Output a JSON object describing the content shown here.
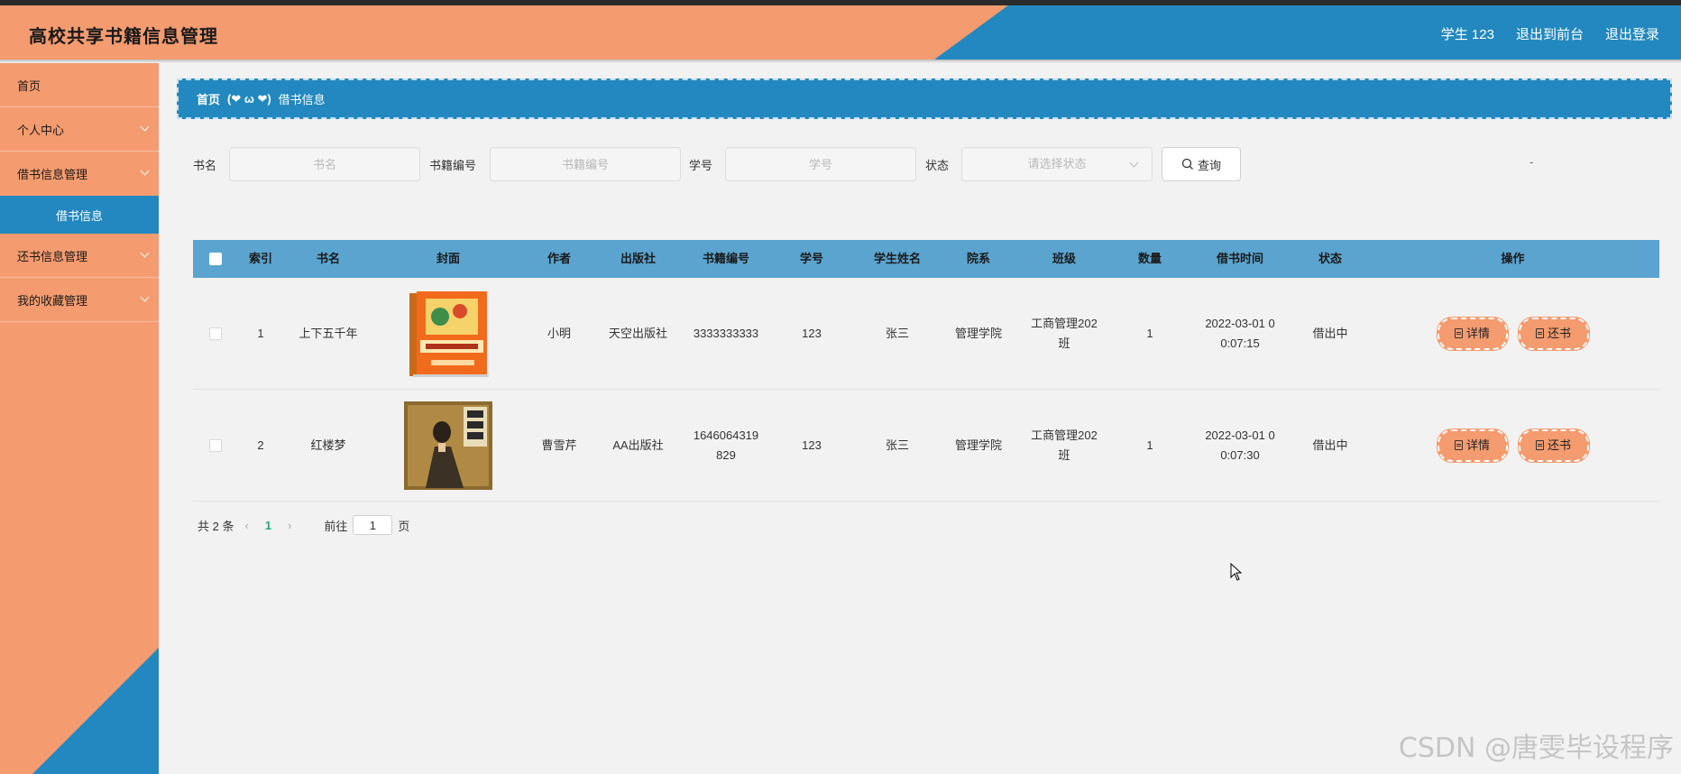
{
  "header": {
    "title": "高校共享书籍信息管理",
    "user": "学生 123",
    "to_front": "退出到前台",
    "logout": "退出登录"
  },
  "sidebar": {
    "items": [
      {
        "label": "首页"
      },
      {
        "label": "个人中心"
      },
      {
        "label": "借书信息管理"
      },
      {
        "label": "借书信息"
      },
      {
        "label": "还书信息管理"
      },
      {
        "label": "我的收藏管理"
      }
    ]
  },
  "breadcrumb": {
    "home": "首页",
    "sep": "(❤ ω ❤)",
    "current": "借书信息"
  },
  "search": {
    "book_name_label": "书名",
    "book_name_placeholder": "书名",
    "book_no_label": "书籍编号",
    "book_no_placeholder": "书籍编号",
    "student_no_label": "学号",
    "student_no_placeholder": "学号",
    "status_label": "状态",
    "status_placeholder": "请选择状态",
    "query_label": "查询",
    "dash": "-"
  },
  "table": {
    "headers": [
      "索引",
      "书名",
      "封面",
      "作者",
      "出版社",
      "书籍编号",
      "学号",
      "学生姓名",
      "院系",
      "班级",
      "数量",
      "借书时间",
      "状态",
      "操作"
    ],
    "rows": [
      {
        "index": "1",
        "name": "上下五千年",
        "author": "小明",
        "publisher": "天空出版社",
        "book_no": "3333333333",
        "student_no": "123",
        "student_name": "张三",
        "department": "管理学院",
        "class": "工商管理202班",
        "quantity": "1",
        "time": "2022-03-01 00:07:15",
        "status": "借出中",
        "detail": "详情",
        "return": "还书"
      },
      {
        "index": "2",
        "name": "红楼梦",
        "author": "曹雪芹",
        "publisher": "AA出版社",
        "book_no": "1646064319829",
        "student_no": "123",
        "student_name": "张三",
        "department": "管理学院",
        "class": "工商管理202班",
        "quantity": "1",
        "time": "2022-03-01 00:07:30",
        "status": "借出中",
        "detail": "详情",
        "return": "还书"
      }
    ]
  },
  "pager": {
    "total": "共 2 条",
    "current": "1",
    "goto": "前往",
    "page_value": "1",
    "page_suffix": "页"
  },
  "watermark": "CSDN @唐雯毕设程序"
}
